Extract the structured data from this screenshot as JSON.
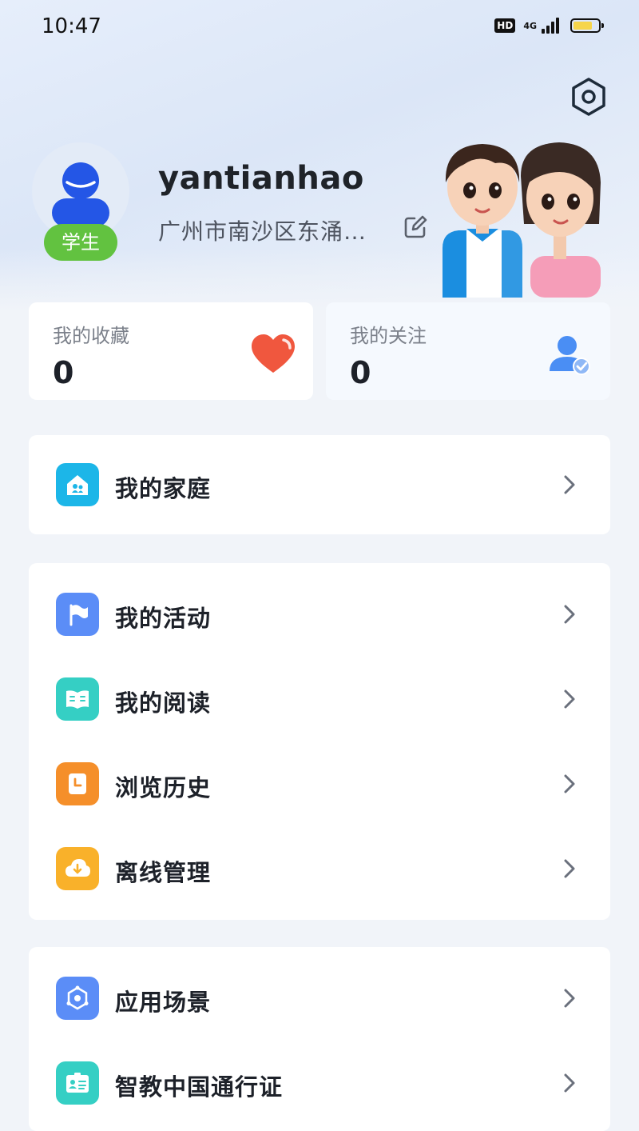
{
  "status_bar": {
    "time": "10:47",
    "hd": "HD",
    "network": "4G",
    "battery_percent": 75
  },
  "profile": {
    "username": "yantianhao",
    "role": "学生",
    "location": "广州市南沙区东涌…"
  },
  "stats": [
    {
      "label": "我的收藏",
      "value": "0",
      "icon": "heart-icon"
    },
    {
      "label": "我的关注",
      "value": "0",
      "icon": "user-check-icon"
    }
  ],
  "menu_groups": [
    {
      "items": [
        {
          "label": "我的家庭",
          "icon": "home-icon"
        }
      ]
    },
    {
      "items": [
        {
          "label": "我的活动",
          "icon": "flag-icon"
        },
        {
          "label": "我的阅读",
          "icon": "book-icon"
        },
        {
          "label": "浏览历史",
          "icon": "history-icon"
        },
        {
          "label": "离线管理",
          "icon": "download-cloud-icon"
        }
      ]
    },
    {
      "items": [
        {
          "label": "应用场景",
          "icon": "scene-icon"
        },
        {
          "label": "智教中国通行证",
          "icon": "id-card-icon"
        }
      ]
    }
  ],
  "colors": {
    "role_badge": "#62c240",
    "heart": "#f0573e",
    "home_icon": "#1cb6e8",
    "flag_icon": "#5b8df7",
    "book_icon": "#35cfc4",
    "history_icon": "#f58f2a",
    "download_icon": "#f9b12a",
    "scene_icon": "#5b8df7",
    "id_card_icon": "#35cfc4"
  }
}
